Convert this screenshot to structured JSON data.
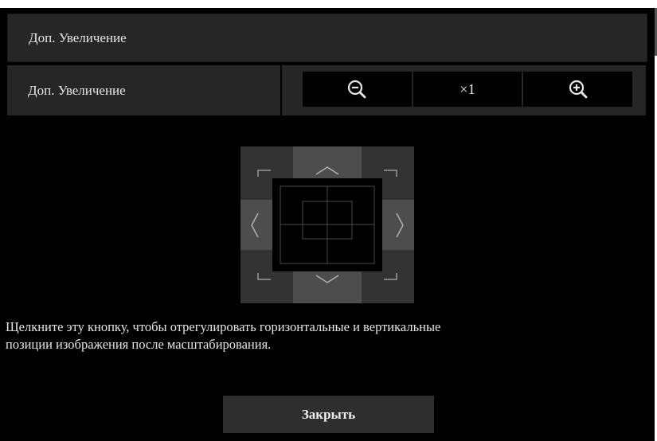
{
  "header": {
    "title": "Доп. Увеличение"
  },
  "zoom": {
    "label": "Доп. Увеличение",
    "zoom_out_icon": "zoom-out-icon",
    "level": "×1",
    "zoom_in_icon": "zoom-in-icon"
  },
  "position_pad": {
    "icons": [
      "corner-top-left-icon",
      "arrow-up-icon",
      "corner-top-right-icon",
      "arrow-left-icon",
      "target-frame-icon",
      "arrow-right-icon",
      "corner-bottom-left-icon",
      "arrow-down-icon",
      "corner-bottom-right-icon"
    ]
  },
  "hint": {
    "line1": "Щелкните эту кнопку, чтобы отрегулировать горизонтальные и вертикальные",
    "line2": "позиции изображения после масштабирования."
  },
  "close_button": {
    "label": "Закрыть"
  },
  "colors": {
    "background": "#000000",
    "row": "#262626",
    "pad_edge": "#4d4d4d",
    "pad_corner": "#333333",
    "button": "#2e2e2e"
  }
}
